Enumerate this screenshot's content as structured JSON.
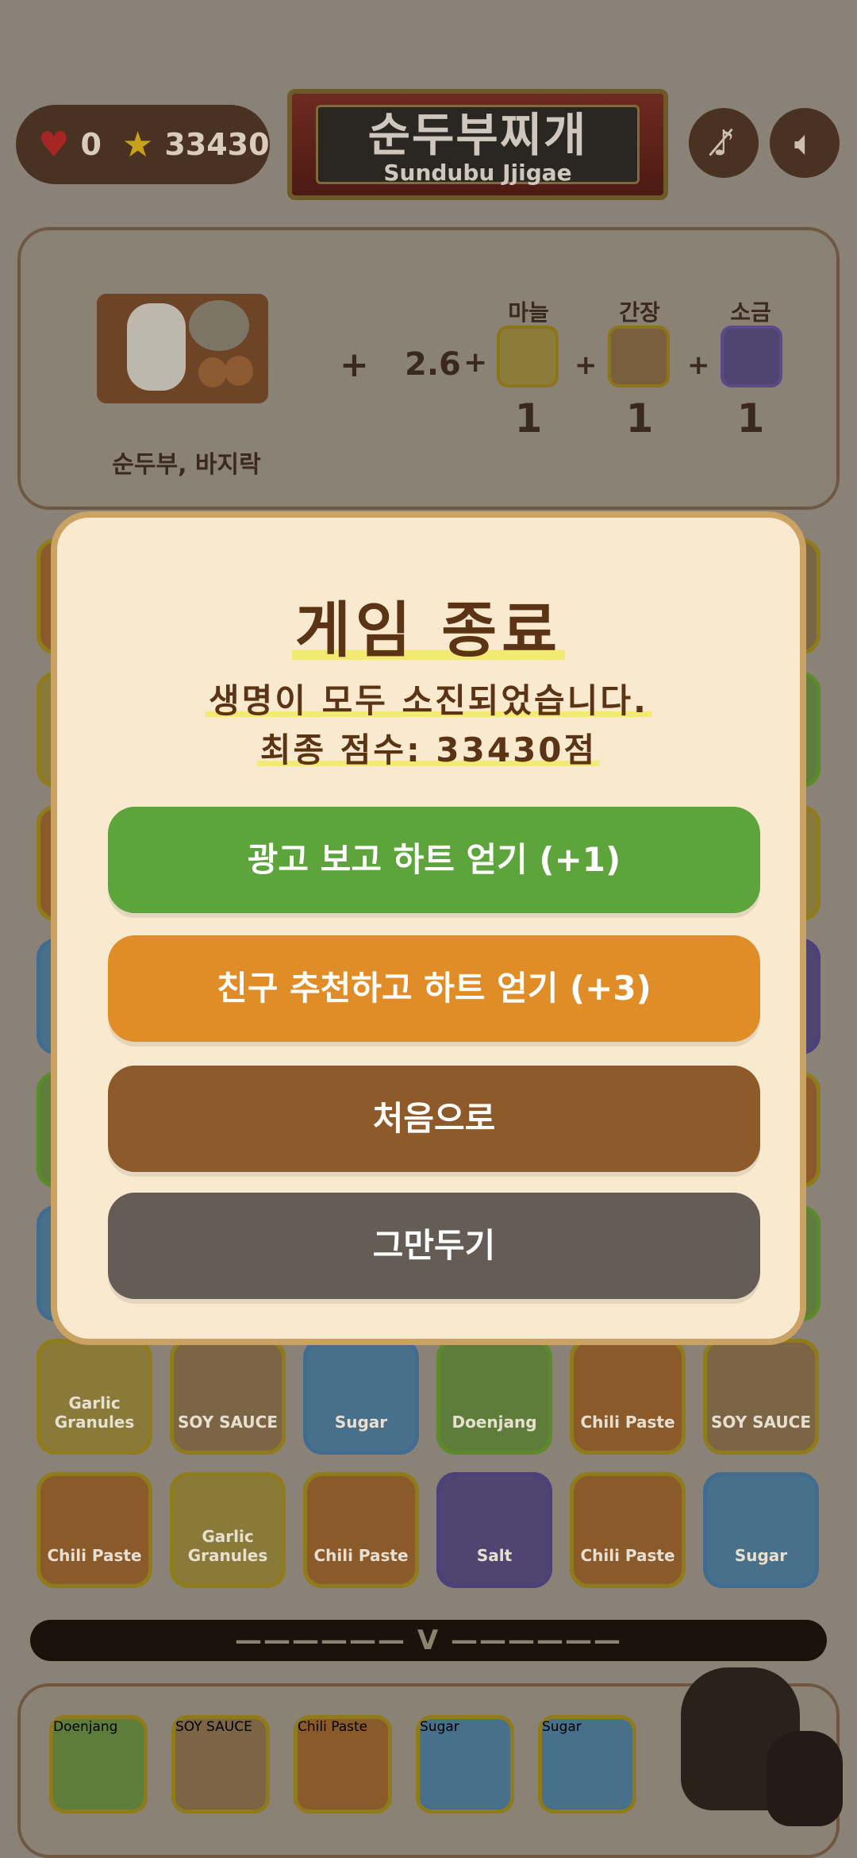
{
  "hud": {
    "hearts": "0",
    "score": "33430"
  },
  "title": {
    "korean": "순두부찌개",
    "english": "Sundubu Jjigae"
  },
  "controls": {
    "music_icon": "music-off-icon",
    "sound_icon": "speaker-icon"
  },
  "recipe": {
    "base_label": "순두부, 바지락",
    "plus": "+",
    "multiplier": "2.6",
    "ingredients": [
      {
        "name": "마늘",
        "qty": "1"
      },
      {
        "name": "간장",
        "qty": "1"
      },
      {
        "name": "소금",
        "qty": "1"
      }
    ]
  },
  "board_tiles": {
    "row1": [
      "Garlic Granules",
      "SOY SAUCE",
      "Sugar",
      "Doenjang",
      "Chili Paste",
      "SOY SAUCE"
    ],
    "row2": [
      "Chili Paste",
      "Garlic Granules",
      "Chili Paste",
      "Salt",
      "Chili Paste",
      "Sugar"
    ]
  },
  "divider": {
    "text": "——————  V  ——————"
  },
  "tray_tiles": [
    "Doenjang",
    "SOY SAUCE",
    "Chili Paste",
    "Sugar",
    "Sugar"
  ],
  "modal": {
    "title": "게임 종료",
    "line1": "생명이 모두 소진되었습니다.",
    "line2": "최종 점수: 33430점",
    "btn_ad": "광고 보고 하트 얻기 (+1)",
    "btn_friend": "친구 추천하고 하트 얻기 (+3)",
    "btn_home": "처음으로",
    "btn_quit": "그만두기"
  },
  "colors": {
    "green_button": "#5ea43c",
    "orange_button": "#e08d27",
    "brown_button": "#8e5a2a",
    "gray_button": "#655c55",
    "modal_bg": "#f8e9cf",
    "title_text": "#5a3415"
  }
}
